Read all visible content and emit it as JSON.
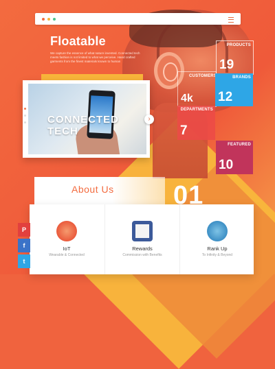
{
  "brand": {
    "name": "Floatable",
    "tagline": "We capture the essence of what nature invented. Connected tech meets fashion is not limited to what we perceive. Hand crafted garments from the finest materials known to human"
  },
  "colors": {
    "accent": "#f36b3f",
    "yellow": "#f8b43a",
    "blue": "#2ea6e6",
    "red": "#ec4a48",
    "crimson": "#c1345b"
  },
  "browser": {
    "dots": [
      "#f36b3f",
      "#f8b43a",
      "#4cc38a"
    ],
    "menu_icon": "hamburger-icon"
  },
  "slider": {
    "caption_line1": "CONNECTED",
    "caption_line2": "TECH",
    "next_icon": "chevron-right-icon",
    "next_glyph": "›"
  },
  "stats": [
    {
      "label": "PRODUCTS",
      "value": "19"
    },
    {
      "label": "CUSTOMERS",
      "value": "4k"
    },
    {
      "label": "BRANDS",
      "value": "12"
    },
    {
      "label": "DEPARTMENTS",
      "value": "7"
    },
    {
      "label": "FEATURED",
      "value": "10"
    }
  ],
  "about": {
    "title": "About Us",
    "number": "01"
  },
  "features": [
    {
      "title": "IoT",
      "subtitle": "Wearable & Connected",
      "icon": "iot-icon"
    },
    {
      "title": "Rewards",
      "subtitle": "Commission with Benefits",
      "icon": "rewards-icon"
    },
    {
      "title": "Rank Up",
      "subtitle": "To Infinity & Beyond",
      "icon": "rank-up-icon"
    }
  ],
  "social": [
    {
      "glyph": "P",
      "icon": "pinterest-icon",
      "color": "#e2403e"
    },
    {
      "glyph": "f",
      "icon": "facebook-icon",
      "color": "#3b73c8"
    },
    {
      "glyph": "t",
      "icon": "twitter-icon",
      "color": "#2ea6e6"
    }
  ]
}
